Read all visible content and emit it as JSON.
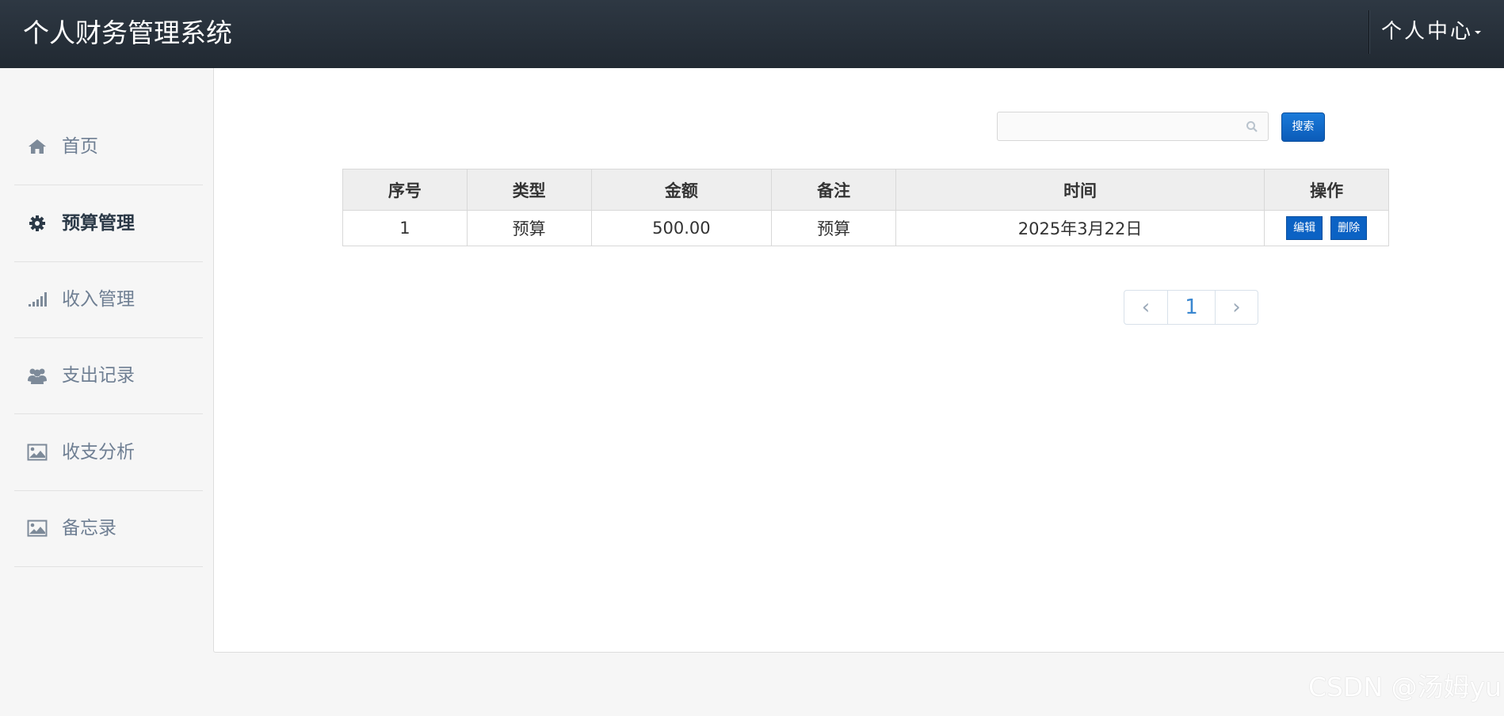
{
  "header": {
    "title": "个人财务管理系统",
    "user_menu_label": "个人中心"
  },
  "sidebar": {
    "items": [
      {
        "label": "首页",
        "icon": "home-icon",
        "active": false
      },
      {
        "label": "预算管理",
        "icon": "gear-icon",
        "active": true
      },
      {
        "label": "收入管理",
        "icon": "signal-bars-icon",
        "active": false
      },
      {
        "label": "支出记录",
        "icon": "users-icon",
        "active": false
      },
      {
        "label": "收支分析",
        "icon": "image-icon",
        "active": false
      },
      {
        "label": "备忘录",
        "icon": "image-icon",
        "active": false
      }
    ]
  },
  "search": {
    "value": "",
    "placeholder": "",
    "button_label": "搜索"
  },
  "table": {
    "columns": [
      "序号",
      "类型",
      "金额",
      "备注",
      "时间",
      "操作"
    ],
    "rows": [
      {
        "index": "1",
        "type": "预算",
        "amount": "500.00",
        "note": "预算",
        "time": "2025年3月22日",
        "edit_label": "编辑",
        "delete_label": "删除"
      }
    ]
  },
  "pagination": {
    "prev": "‹",
    "current_page": "1",
    "next": "›"
  },
  "watermark": "CSDN @汤姆yu",
  "colors": {
    "topbar": "#252e38",
    "primary_button": "#0b62c4",
    "sidebar_active_text": "#2b3947",
    "sidebar_text": "#6f7f93"
  }
}
